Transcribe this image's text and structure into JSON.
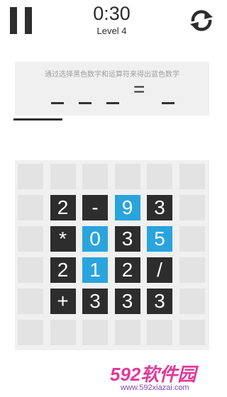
{
  "header": {
    "timer": "0:30",
    "level": "Level 4"
  },
  "puzzle": {
    "hint": "通过选择黑色数字和运算符来得出蓝色数字",
    "equals": "=",
    "blank_count_left": 3,
    "blank_count_right": 1
  },
  "progress": {
    "fraction": 0.25
  },
  "board": {
    "rows": [
      [
        {
          "v": "",
          "t": "empty"
        },
        {
          "v": "",
          "t": "empty"
        },
        {
          "v": "",
          "t": "empty"
        },
        {
          "v": "",
          "t": "empty"
        },
        {
          "v": "",
          "t": "empty"
        },
        {
          "v": "",
          "t": "empty"
        }
      ],
      [
        {
          "v": "",
          "t": "empty"
        },
        {
          "v": "2",
          "t": "black"
        },
        {
          "v": "-",
          "t": "black"
        },
        {
          "v": "9",
          "t": "blue"
        },
        {
          "v": "3",
          "t": "black"
        },
        {
          "v": "",
          "t": "empty"
        }
      ],
      [
        {
          "v": "",
          "t": "empty"
        },
        {
          "v": "*",
          "t": "black"
        },
        {
          "v": "0",
          "t": "blue"
        },
        {
          "v": "3",
          "t": "black"
        },
        {
          "v": "5",
          "t": "blue"
        },
        {
          "v": "",
          "t": "empty"
        }
      ],
      [
        {
          "v": "",
          "t": "empty"
        },
        {
          "v": "2",
          "t": "black"
        },
        {
          "v": "1",
          "t": "blue"
        },
        {
          "v": "2",
          "t": "black"
        },
        {
          "v": "/",
          "t": "black"
        },
        {
          "v": "",
          "t": "empty"
        }
      ],
      [
        {
          "v": "",
          "t": "empty"
        },
        {
          "v": "+",
          "t": "black"
        },
        {
          "v": "3",
          "t": "black"
        },
        {
          "v": "3",
          "t": "black"
        },
        {
          "v": "3",
          "t": "black"
        },
        {
          "v": "",
          "t": "empty"
        }
      ],
      [
        {
          "v": "",
          "t": "empty"
        },
        {
          "v": "",
          "t": "empty"
        },
        {
          "v": "",
          "t": "empty"
        },
        {
          "v": "",
          "t": "empty"
        },
        {
          "v": "",
          "t": "empty"
        },
        {
          "v": "",
          "t": "empty"
        }
      ]
    ]
  },
  "watermark": {
    "logo": "592软件园",
    "url": "www.592xiazai.com"
  },
  "colors": {
    "tile_dark": "#2d2d2d",
    "tile_blue": "#2aa4dd",
    "tile_empty": "#e3e3e3",
    "panel": "#f0f0f0"
  }
}
